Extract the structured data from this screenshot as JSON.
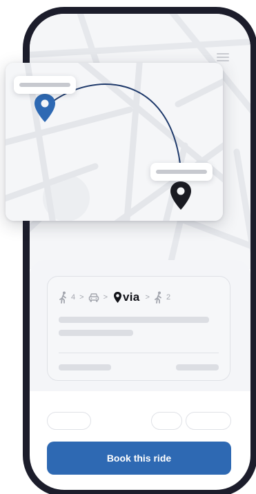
{
  "colors": {
    "phone_frame": "#1c1d2b",
    "primary_button": "#2e69b3",
    "route_line": "#1f3a6b",
    "origin_pin": "#2e69b3",
    "destination_pin": "#1a1b22"
  },
  "map_popup": {
    "origin_pin_icon": "location-pin-icon",
    "destination_pin_icon": "location-pin-icon"
  },
  "route_summary": {
    "walk_to_pickup_minutes": "4",
    "ride_brand": "via",
    "walk_from_dropoff_minutes": "2",
    "separator": ">"
  },
  "actions": {
    "book_label": "Book this ride"
  }
}
